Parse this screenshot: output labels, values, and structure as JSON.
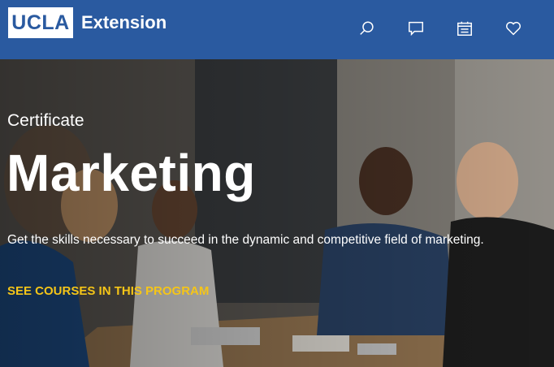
{
  "header": {
    "logo_primary": "UCLA",
    "logo_secondary": "Extension",
    "icons": [
      "search-icon",
      "chat-icon",
      "calendar-icon",
      "heart-icon"
    ]
  },
  "hero": {
    "eyebrow": "Certificate",
    "title": "Marketing",
    "subtitle": "Get the skills necessary to succeed in the dynamic and competitive field of marketing.",
    "cta_label": "SEE COURSES IN THIS PROGRAM"
  },
  "colors": {
    "header_bg": "#2a5aa0",
    "cta": "#f5c518",
    "text": "#ffffff"
  }
}
